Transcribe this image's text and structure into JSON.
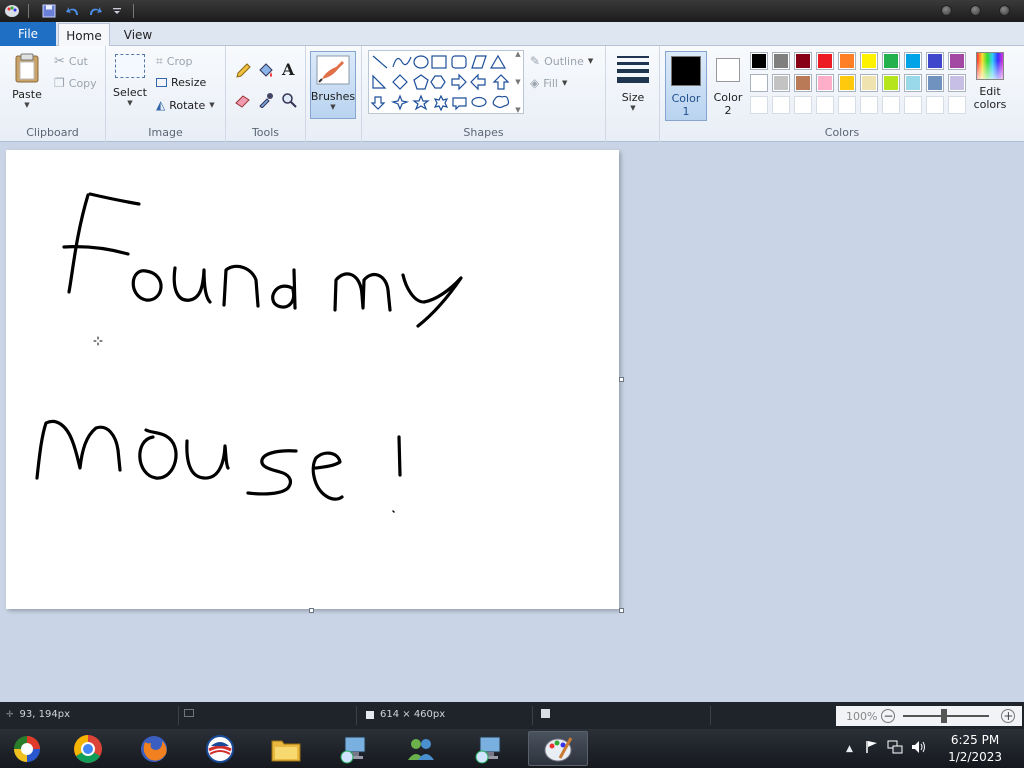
{
  "window": {
    "title_icons": [
      "paint-app-icon",
      "save-icon",
      "undo-icon",
      "redo-icon",
      "customize-quick-access-icon"
    ]
  },
  "tabs": {
    "file": "File",
    "home": "Home",
    "view": "View"
  },
  "ribbon": {
    "clipboard": {
      "label": "Clipboard",
      "paste": "Paste",
      "cut": "Cut",
      "copy": "Copy"
    },
    "image": {
      "label": "Image",
      "select": "Select",
      "crop": "Crop",
      "resize": "Resize",
      "rotate": "Rotate"
    },
    "tools": {
      "label": "Tools"
    },
    "brushes": {
      "label": "Brushes"
    },
    "shapes": {
      "label": "Shapes",
      "outline": "Outline",
      "fill": "Fill"
    },
    "size": {
      "label": "Size"
    },
    "colors": {
      "label": "Colors",
      "color1_label": "Color",
      "color1_num": "1",
      "color2_label": "Color",
      "color2_num": "2",
      "edit_label": "Edit",
      "edit_label2": "colors",
      "color1_value": "#000000",
      "color2_value": "#ffffff",
      "row1": [
        "#000000",
        "#7f7f7f",
        "#880015",
        "#ed1c24",
        "#ff7f27",
        "#fff200",
        "#22b14c",
        "#00a2e8",
        "#3f48cc",
        "#a349a4"
      ],
      "row2": [
        "#ffffff",
        "#c3c3c3",
        "#b97a57",
        "#ffaec9",
        "#ffc90e",
        "#efe4b0",
        "#b5e61d",
        "#99d9ea",
        "#7092be",
        "#c8bfe7"
      ]
    }
  },
  "statusbar": {
    "cursor_position": "93, 194px",
    "canvas_size": "614 × 460px",
    "zoom": "100%"
  },
  "taskbar": {
    "time": "6:25 PM",
    "date": "1/2/2023"
  }
}
